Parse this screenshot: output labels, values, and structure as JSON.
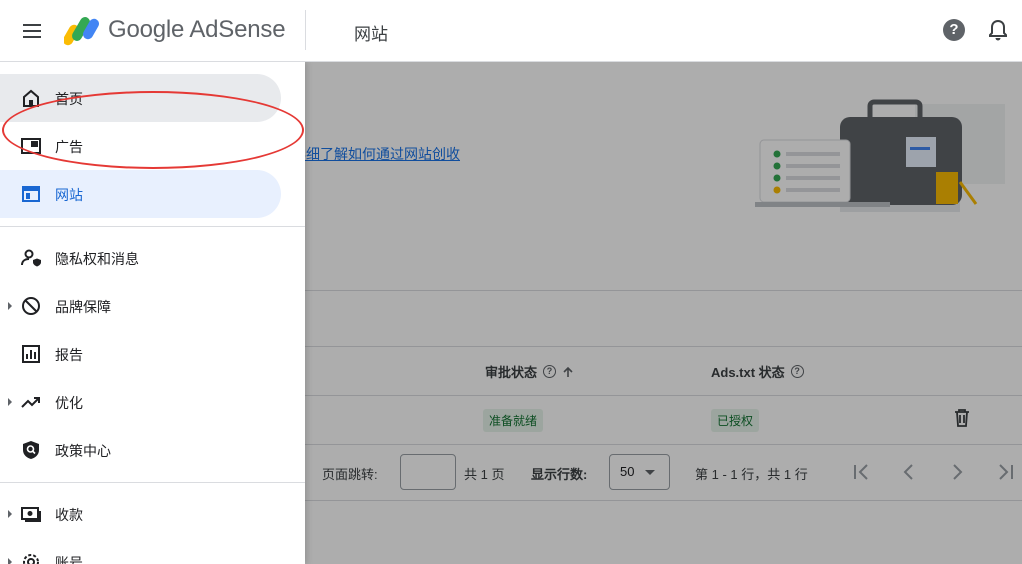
{
  "header": {
    "brand": "Google AdSense",
    "page_title": "网站",
    "help_glyph": "?"
  },
  "sidebar": {
    "items": [
      {
        "label": "首页",
        "icon": "home-icon"
      },
      {
        "label": "广告",
        "icon": "ads-icon"
      },
      {
        "label": "网站",
        "icon": "sites-icon"
      },
      {
        "label": "隐私权和消息",
        "icon": "privacy-icon"
      },
      {
        "label": "品牌保障",
        "icon": "block-icon"
      },
      {
        "label": "报告",
        "icon": "reports-icon"
      },
      {
        "label": "优化",
        "icon": "trending-icon"
      },
      {
        "label": "政策中心",
        "icon": "policy-shield-icon"
      },
      {
        "label": "收款",
        "icon": "payments-icon"
      },
      {
        "label": "账号",
        "icon": "settings-icon"
      }
    ]
  },
  "main": {
    "learn_link": "详细了解如何通过网站创收",
    "columns": {
      "approval_status": "审批状态",
      "ads_txt_status": "Ads.txt 状态"
    },
    "row": {
      "approval_value": "准备就绪",
      "ads_txt_value": "已授权"
    },
    "pagination": {
      "goto_label": "页面跳转:",
      "total_pages": "共 1 页",
      "rows_label": "显示行数:",
      "rows_value": "50",
      "range": "第 1 - 1 行，共 1 行"
    }
  },
  "colors": {
    "accent": "#1a73e8",
    "highlight": "#e53935",
    "chip_bg": "#e6f4ea",
    "chip_text": "#137333"
  }
}
